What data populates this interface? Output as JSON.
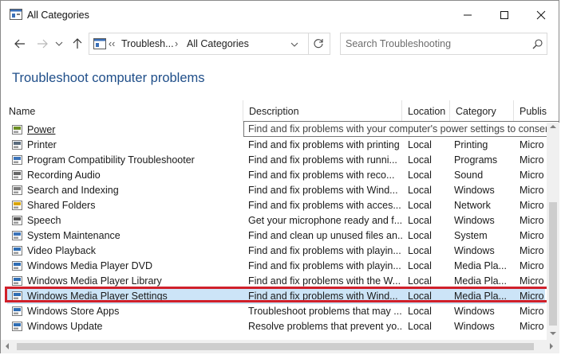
{
  "window": {
    "title": "All Categories",
    "controls": [
      "minimize",
      "maximize",
      "close"
    ]
  },
  "address_bar": {
    "prefix": "‹‹",
    "crumbs": [
      "Troublesh...",
      "All Categories"
    ],
    "separator": "›"
  },
  "search": {
    "placeholder": "Search Troubleshooting"
  },
  "heading": "Troubleshoot computer problems",
  "columns": [
    "Name",
    "Description",
    "Location",
    "Category",
    "Publis"
  ],
  "tooltip": "Find and fix problems with your computer's power settings to conserve po",
  "rows": [
    {
      "name": "Power",
      "description": "",
      "location": "",
      "category": "",
      "publisher": "",
      "icon": "power-icon"
    },
    {
      "name": "Printer",
      "description": "Find and fix problems with printing",
      "location": "Local",
      "category": "Printing",
      "publisher": "Micro",
      "icon": "printer-icon"
    },
    {
      "name": "Program Compatibility Troubleshooter",
      "description": "Find and fix problems with runni...",
      "location": "Local",
      "category": "Programs",
      "publisher": "Micro",
      "icon": "program-icon"
    },
    {
      "name": "Recording Audio",
      "description": "Find and fix problems with reco...",
      "location": "Local",
      "category": "Sound",
      "publisher": "Micro",
      "icon": "microphone-icon"
    },
    {
      "name": "Search and Indexing",
      "description": "Find and fix problems with Wind...",
      "location": "Local",
      "category": "Windows",
      "publisher": "Micro",
      "icon": "search-icon"
    },
    {
      "name": "Shared Folders",
      "description": "Find and fix problems with acces...",
      "location": "Local",
      "category": "Network",
      "publisher": "Micro",
      "icon": "folder-icon"
    },
    {
      "name": "Speech",
      "description": "Get your microphone ready and f...",
      "location": "Local",
      "category": "Windows",
      "publisher": "Micro",
      "icon": "speech-icon"
    },
    {
      "name": "System Maintenance",
      "description": "Find and clean up unused files an...",
      "location": "Local",
      "category": "System",
      "publisher": "Micro",
      "icon": "maintenance-icon"
    },
    {
      "name": "Video Playback",
      "description": "Find and fix problems with playin...",
      "location": "Local",
      "category": "Windows",
      "publisher": "Micro",
      "icon": "video-icon"
    },
    {
      "name": "Windows Media Player DVD",
      "description": "Find and fix problems with playin...",
      "location": "Local",
      "category": "Media Pla...",
      "publisher": "Micro",
      "icon": "dvd-icon"
    },
    {
      "name": "Windows Media Player Library",
      "description": "Find and fix problems with the W...",
      "location": "Local",
      "category": "Media Pla...",
      "publisher": "Micro",
      "icon": "library-icon"
    },
    {
      "name": "Windows Media Player Settings",
      "description": "Find and fix problems with Wind...",
      "location": "Local",
      "category": "Media Pla...",
      "publisher": "Micro",
      "icon": "settings-icon",
      "selected": true
    },
    {
      "name": "Windows Store Apps",
      "description": "Troubleshoot problems that may ...",
      "location": "Local",
      "category": "Windows",
      "publisher": "Micro",
      "icon": "store-icon"
    },
    {
      "name": "Windows Update",
      "description": "Resolve problems that prevent yo...",
      "location": "Local",
      "category": "Windows",
      "publisher": "Micro",
      "icon": "update-icon"
    }
  ],
  "colors": {
    "heading": "#1f4e89",
    "selection": "#cce4f7",
    "highlight_border": "#d0202a"
  }
}
